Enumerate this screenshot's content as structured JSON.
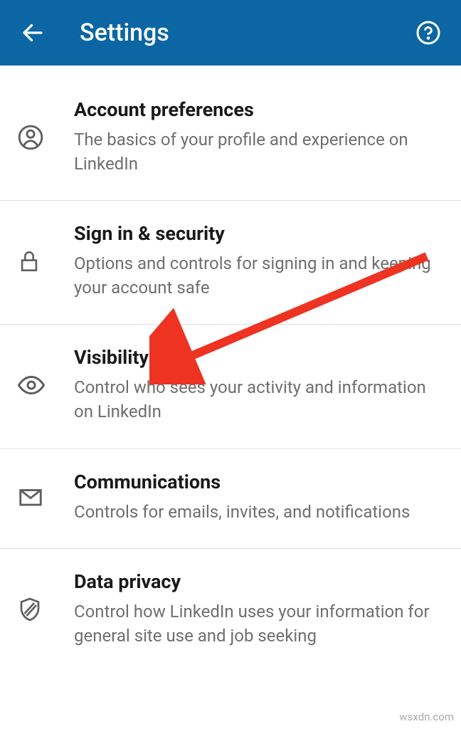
{
  "header": {
    "title": "Settings"
  },
  "sections": {
    "account": {
      "title": "Account preferences",
      "desc": "The basics of your profile and experience on LinkedIn"
    },
    "signin": {
      "title": "Sign in & security",
      "desc": "Options and controls for signing in and keeping your account safe"
    },
    "visibility": {
      "title": "Visibility",
      "desc": "Control who sees your activity and information on LinkedIn"
    },
    "communications": {
      "title": "Communications",
      "desc": "Controls for emails, invites, and notifications"
    },
    "privacy": {
      "title": "Data privacy",
      "desc": "Control how LinkedIn uses your information for general site use and job seeking"
    }
  },
  "watermark": "wsxdn.com"
}
